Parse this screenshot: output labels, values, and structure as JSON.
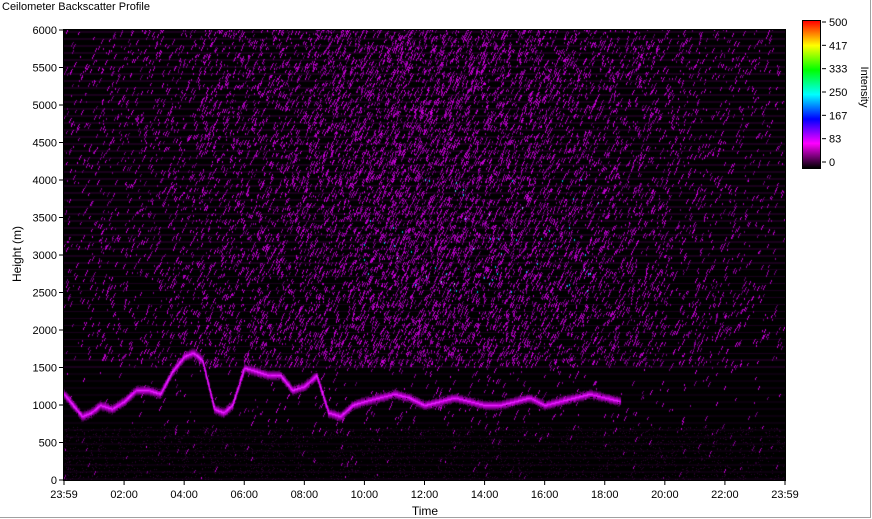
{
  "window": {
    "title": "Ceilometer Backscatter Profile"
  },
  "chart_data": {
    "type": "heatmap",
    "title": "Ceilometer Backscatter Profile",
    "xlabel": "Time",
    "ylabel": "Height (m)",
    "x_tick_labels": [
      "23:59",
      "02:00",
      "04:00",
      "06:00",
      "08:00",
      "10:00",
      "12:00",
      "14:00",
      "16:00",
      "18:00",
      "20:00",
      "22:00",
      "23:59"
    ],
    "y_ticks": [
      0,
      500,
      1000,
      1500,
      2000,
      2500,
      3000,
      3500,
      4000,
      4500,
      5000,
      5500,
      6000
    ],
    "xlim_hours": [
      0,
      24
    ],
    "ylim": [
      0,
      6000
    ],
    "colorbar": {
      "label": "Intensity",
      "range": [
        0,
        500
      ],
      "tick_labels": [
        "500",
        "417",
        "333",
        "250",
        "167",
        "83",
        "0"
      ],
      "colors": [
        "#000000",
        "#ff00ff",
        "#0000ff",
        "#00ffff",
        "#00ff00",
        "#ffff00",
        "#ff0000"
      ]
    },
    "cloud_layer": {
      "description_hours": [
        0.0,
        0.3,
        0.6,
        0.9,
        1.2,
        1.6,
        2.0,
        2.4,
        2.8,
        3.2,
        3.6,
        4.0,
        4.3,
        4.6,
        5.0,
        5.3,
        5.6,
        6.0,
        6.4,
        6.8,
        7.2,
        7.6,
        8.0,
        8.4,
        8.8,
        9.2,
        9.6,
        10.0,
        10.5,
        11.0,
        11.5,
        12.0,
        12.5,
        13.0,
        13.5,
        14.0,
        14.5,
        15.0,
        15.5,
        16.0,
        16.5,
        17.0,
        17.5,
        18.0,
        18.5
      ],
      "height_m": [
        1150,
        1000,
        850,
        900,
        1000,
        950,
        1050,
        1200,
        1200,
        1150,
        1450,
        1650,
        1700,
        1600,
        950,
        900,
        1000,
        1500,
        1450,
        1400,
        1400,
        1200,
        1250,
        1400,
        900,
        850,
        1000,
        1050,
        1100,
        1150,
        1100,
        1000,
        1050,
        1100,
        1050,
        1000,
        1000,
        1050,
        1100,
        1000,
        1050,
        1100,
        1150,
        1100,
        1050
      ]
    }
  }
}
